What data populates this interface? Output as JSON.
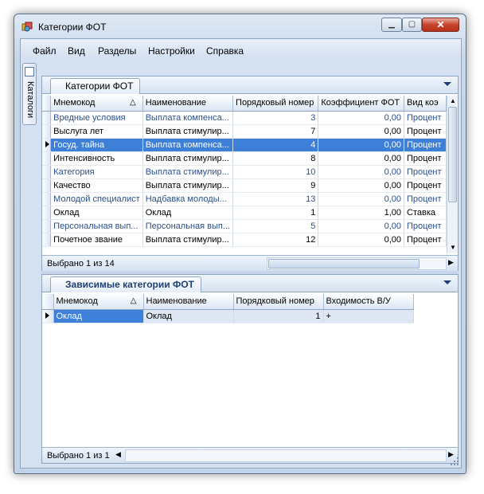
{
  "window": {
    "title": "Категории ФОТ"
  },
  "menu": [
    "Файл",
    "Вид",
    "Разделы",
    "Настройки",
    "Справка"
  ],
  "sidebar": {
    "tab_label": "Каталоги"
  },
  "top_pane": {
    "tab_label": "Категории ФОТ",
    "columns": [
      "Мнемокод",
      "Наименование",
      "Порядковый номер",
      "Коэффициент ФОТ",
      "Вид коэ"
    ],
    "rows": [
      [
        "Вредные условия",
        "Выплата компенса...",
        "3",
        "0,00",
        "Процент"
      ],
      [
        "Выслуга лет",
        "Выплата стимулир...",
        "7",
        "0,00",
        "Процент"
      ],
      [
        "Госуд. тайна",
        "Выплата компенса...",
        "4",
        "0,00",
        "Процент"
      ],
      [
        "Интенсивность",
        "Выплата стимулир...",
        "8",
        "0,00",
        "Процент"
      ],
      [
        "Категория",
        "Выплата стимулир...",
        "10",
        "0,00",
        "Процент"
      ],
      [
        "Качество",
        "Выплата стимулир...",
        "9",
        "0,00",
        "Процент"
      ],
      [
        "Молодой специалист",
        "Надбавка молоды...",
        "13",
        "0,00",
        "Процент"
      ],
      [
        "Оклад",
        "Оклад",
        "1",
        "1,00",
        "Ставка"
      ],
      [
        "Персональная вып...",
        "Персональная вып...",
        "5",
        "0,00",
        "Процент"
      ],
      [
        "Почетное звание",
        "Выплата стимулир...",
        "12",
        "0,00",
        "Процент"
      ]
    ],
    "selected_row": 2,
    "status": "Выбрано 1 из 14"
  },
  "bottom_pane": {
    "tab_label": "Зависимые категории ФОТ",
    "columns": [
      "Мнемокод",
      "Наименование",
      "Порядковый номер",
      "Входимость В/У"
    ],
    "rows": [
      [
        "Оклад",
        "Оклад",
        "1",
        "+"
      ]
    ],
    "status": "Выбрано 1 из 1"
  },
  "icons": {
    "app": "app-icon",
    "minimize": "minimize-icon",
    "maximize": "maximize-icon",
    "close": "close-icon",
    "sort": "sort-asc-icon",
    "row_pointer": "row-pointer-icon",
    "pane_menu": "chevron-down-icon",
    "nav_first": "nav-first-icon",
    "nav_prev": "nav-prev-icon",
    "resize_grip": "resize-grip-icon"
  },
  "glyphs": {
    "minimize": "▁",
    "maximize": "▢",
    "close": "✕",
    "sort_asc": "△",
    "nav_first": "⏮",
    "nav_prev": "◀",
    "nav_next": "▶",
    "scroll_up": "▲",
    "scroll_down": "▼"
  },
  "colors": {
    "selection": "#3e7fd8",
    "header_text": "#1e3f73",
    "close_button": "#c8432b"
  }
}
